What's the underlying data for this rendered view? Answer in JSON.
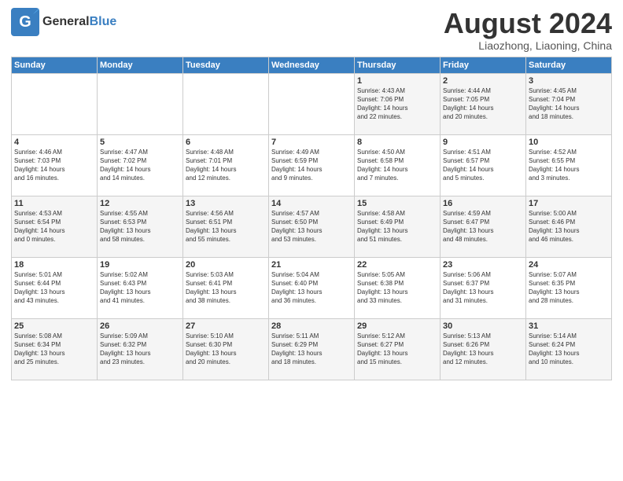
{
  "logo": {
    "line1": "General",
    "line2": "Blue"
  },
  "header": {
    "title": "August 2024",
    "subtitle": "Liaozhong, Liaoning, China"
  },
  "days_of_week": [
    "Sunday",
    "Monday",
    "Tuesday",
    "Wednesday",
    "Thursday",
    "Friday",
    "Saturday"
  ],
  "weeks": [
    [
      {
        "day": "",
        "info": ""
      },
      {
        "day": "",
        "info": ""
      },
      {
        "day": "",
        "info": ""
      },
      {
        "day": "",
        "info": ""
      },
      {
        "day": "1",
        "info": "Sunrise: 4:43 AM\nSunset: 7:06 PM\nDaylight: 14 hours\nand 22 minutes."
      },
      {
        "day": "2",
        "info": "Sunrise: 4:44 AM\nSunset: 7:05 PM\nDaylight: 14 hours\nand 20 minutes."
      },
      {
        "day": "3",
        "info": "Sunrise: 4:45 AM\nSunset: 7:04 PM\nDaylight: 14 hours\nand 18 minutes."
      }
    ],
    [
      {
        "day": "4",
        "info": "Sunrise: 4:46 AM\nSunset: 7:03 PM\nDaylight: 14 hours\nand 16 minutes."
      },
      {
        "day": "5",
        "info": "Sunrise: 4:47 AM\nSunset: 7:02 PM\nDaylight: 14 hours\nand 14 minutes."
      },
      {
        "day": "6",
        "info": "Sunrise: 4:48 AM\nSunset: 7:01 PM\nDaylight: 14 hours\nand 12 minutes."
      },
      {
        "day": "7",
        "info": "Sunrise: 4:49 AM\nSunset: 6:59 PM\nDaylight: 14 hours\nand 9 minutes."
      },
      {
        "day": "8",
        "info": "Sunrise: 4:50 AM\nSunset: 6:58 PM\nDaylight: 14 hours\nand 7 minutes."
      },
      {
        "day": "9",
        "info": "Sunrise: 4:51 AM\nSunset: 6:57 PM\nDaylight: 14 hours\nand 5 minutes."
      },
      {
        "day": "10",
        "info": "Sunrise: 4:52 AM\nSunset: 6:55 PM\nDaylight: 14 hours\nand 3 minutes."
      }
    ],
    [
      {
        "day": "11",
        "info": "Sunrise: 4:53 AM\nSunset: 6:54 PM\nDaylight: 14 hours\nand 0 minutes."
      },
      {
        "day": "12",
        "info": "Sunrise: 4:55 AM\nSunset: 6:53 PM\nDaylight: 13 hours\nand 58 minutes."
      },
      {
        "day": "13",
        "info": "Sunrise: 4:56 AM\nSunset: 6:51 PM\nDaylight: 13 hours\nand 55 minutes."
      },
      {
        "day": "14",
        "info": "Sunrise: 4:57 AM\nSunset: 6:50 PM\nDaylight: 13 hours\nand 53 minutes."
      },
      {
        "day": "15",
        "info": "Sunrise: 4:58 AM\nSunset: 6:49 PM\nDaylight: 13 hours\nand 51 minutes."
      },
      {
        "day": "16",
        "info": "Sunrise: 4:59 AM\nSunset: 6:47 PM\nDaylight: 13 hours\nand 48 minutes."
      },
      {
        "day": "17",
        "info": "Sunrise: 5:00 AM\nSunset: 6:46 PM\nDaylight: 13 hours\nand 46 minutes."
      }
    ],
    [
      {
        "day": "18",
        "info": "Sunrise: 5:01 AM\nSunset: 6:44 PM\nDaylight: 13 hours\nand 43 minutes."
      },
      {
        "day": "19",
        "info": "Sunrise: 5:02 AM\nSunset: 6:43 PM\nDaylight: 13 hours\nand 41 minutes."
      },
      {
        "day": "20",
        "info": "Sunrise: 5:03 AM\nSunset: 6:41 PM\nDaylight: 13 hours\nand 38 minutes."
      },
      {
        "day": "21",
        "info": "Sunrise: 5:04 AM\nSunset: 6:40 PM\nDaylight: 13 hours\nand 36 minutes."
      },
      {
        "day": "22",
        "info": "Sunrise: 5:05 AM\nSunset: 6:38 PM\nDaylight: 13 hours\nand 33 minutes."
      },
      {
        "day": "23",
        "info": "Sunrise: 5:06 AM\nSunset: 6:37 PM\nDaylight: 13 hours\nand 31 minutes."
      },
      {
        "day": "24",
        "info": "Sunrise: 5:07 AM\nSunset: 6:35 PM\nDaylight: 13 hours\nand 28 minutes."
      }
    ],
    [
      {
        "day": "25",
        "info": "Sunrise: 5:08 AM\nSunset: 6:34 PM\nDaylight: 13 hours\nand 25 minutes."
      },
      {
        "day": "26",
        "info": "Sunrise: 5:09 AM\nSunset: 6:32 PM\nDaylight: 13 hours\nand 23 minutes."
      },
      {
        "day": "27",
        "info": "Sunrise: 5:10 AM\nSunset: 6:30 PM\nDaylight: 13 hours\nand 20 minutes."
      },
      {
        "day": "28",
        "info": "Sunrise: 5:11 AM\nSunset: 6:29 PM\nDaylight: 13 hours\nand 18 minutes."
      },
      {
        "day": "29",
        "info": "Sunrise: 5:12 AM\nSunset: 6:27 PM\nDaylight: 13 hours\nand 15 minutes."
      },
      {
        "day": "30",
        "info": "Sunrise: 5:13 AM\nSunset: 6:26 PM\nDaylight: 13 hours\nand 12 minutes."
      },
      {
        "day": "31",
        "info": "Sunrise: 5:14 AM\nSunset: 6:24 PM\nDaylight: 13 hours\nand 10 minutes."
      }
    ]
  ]
}
